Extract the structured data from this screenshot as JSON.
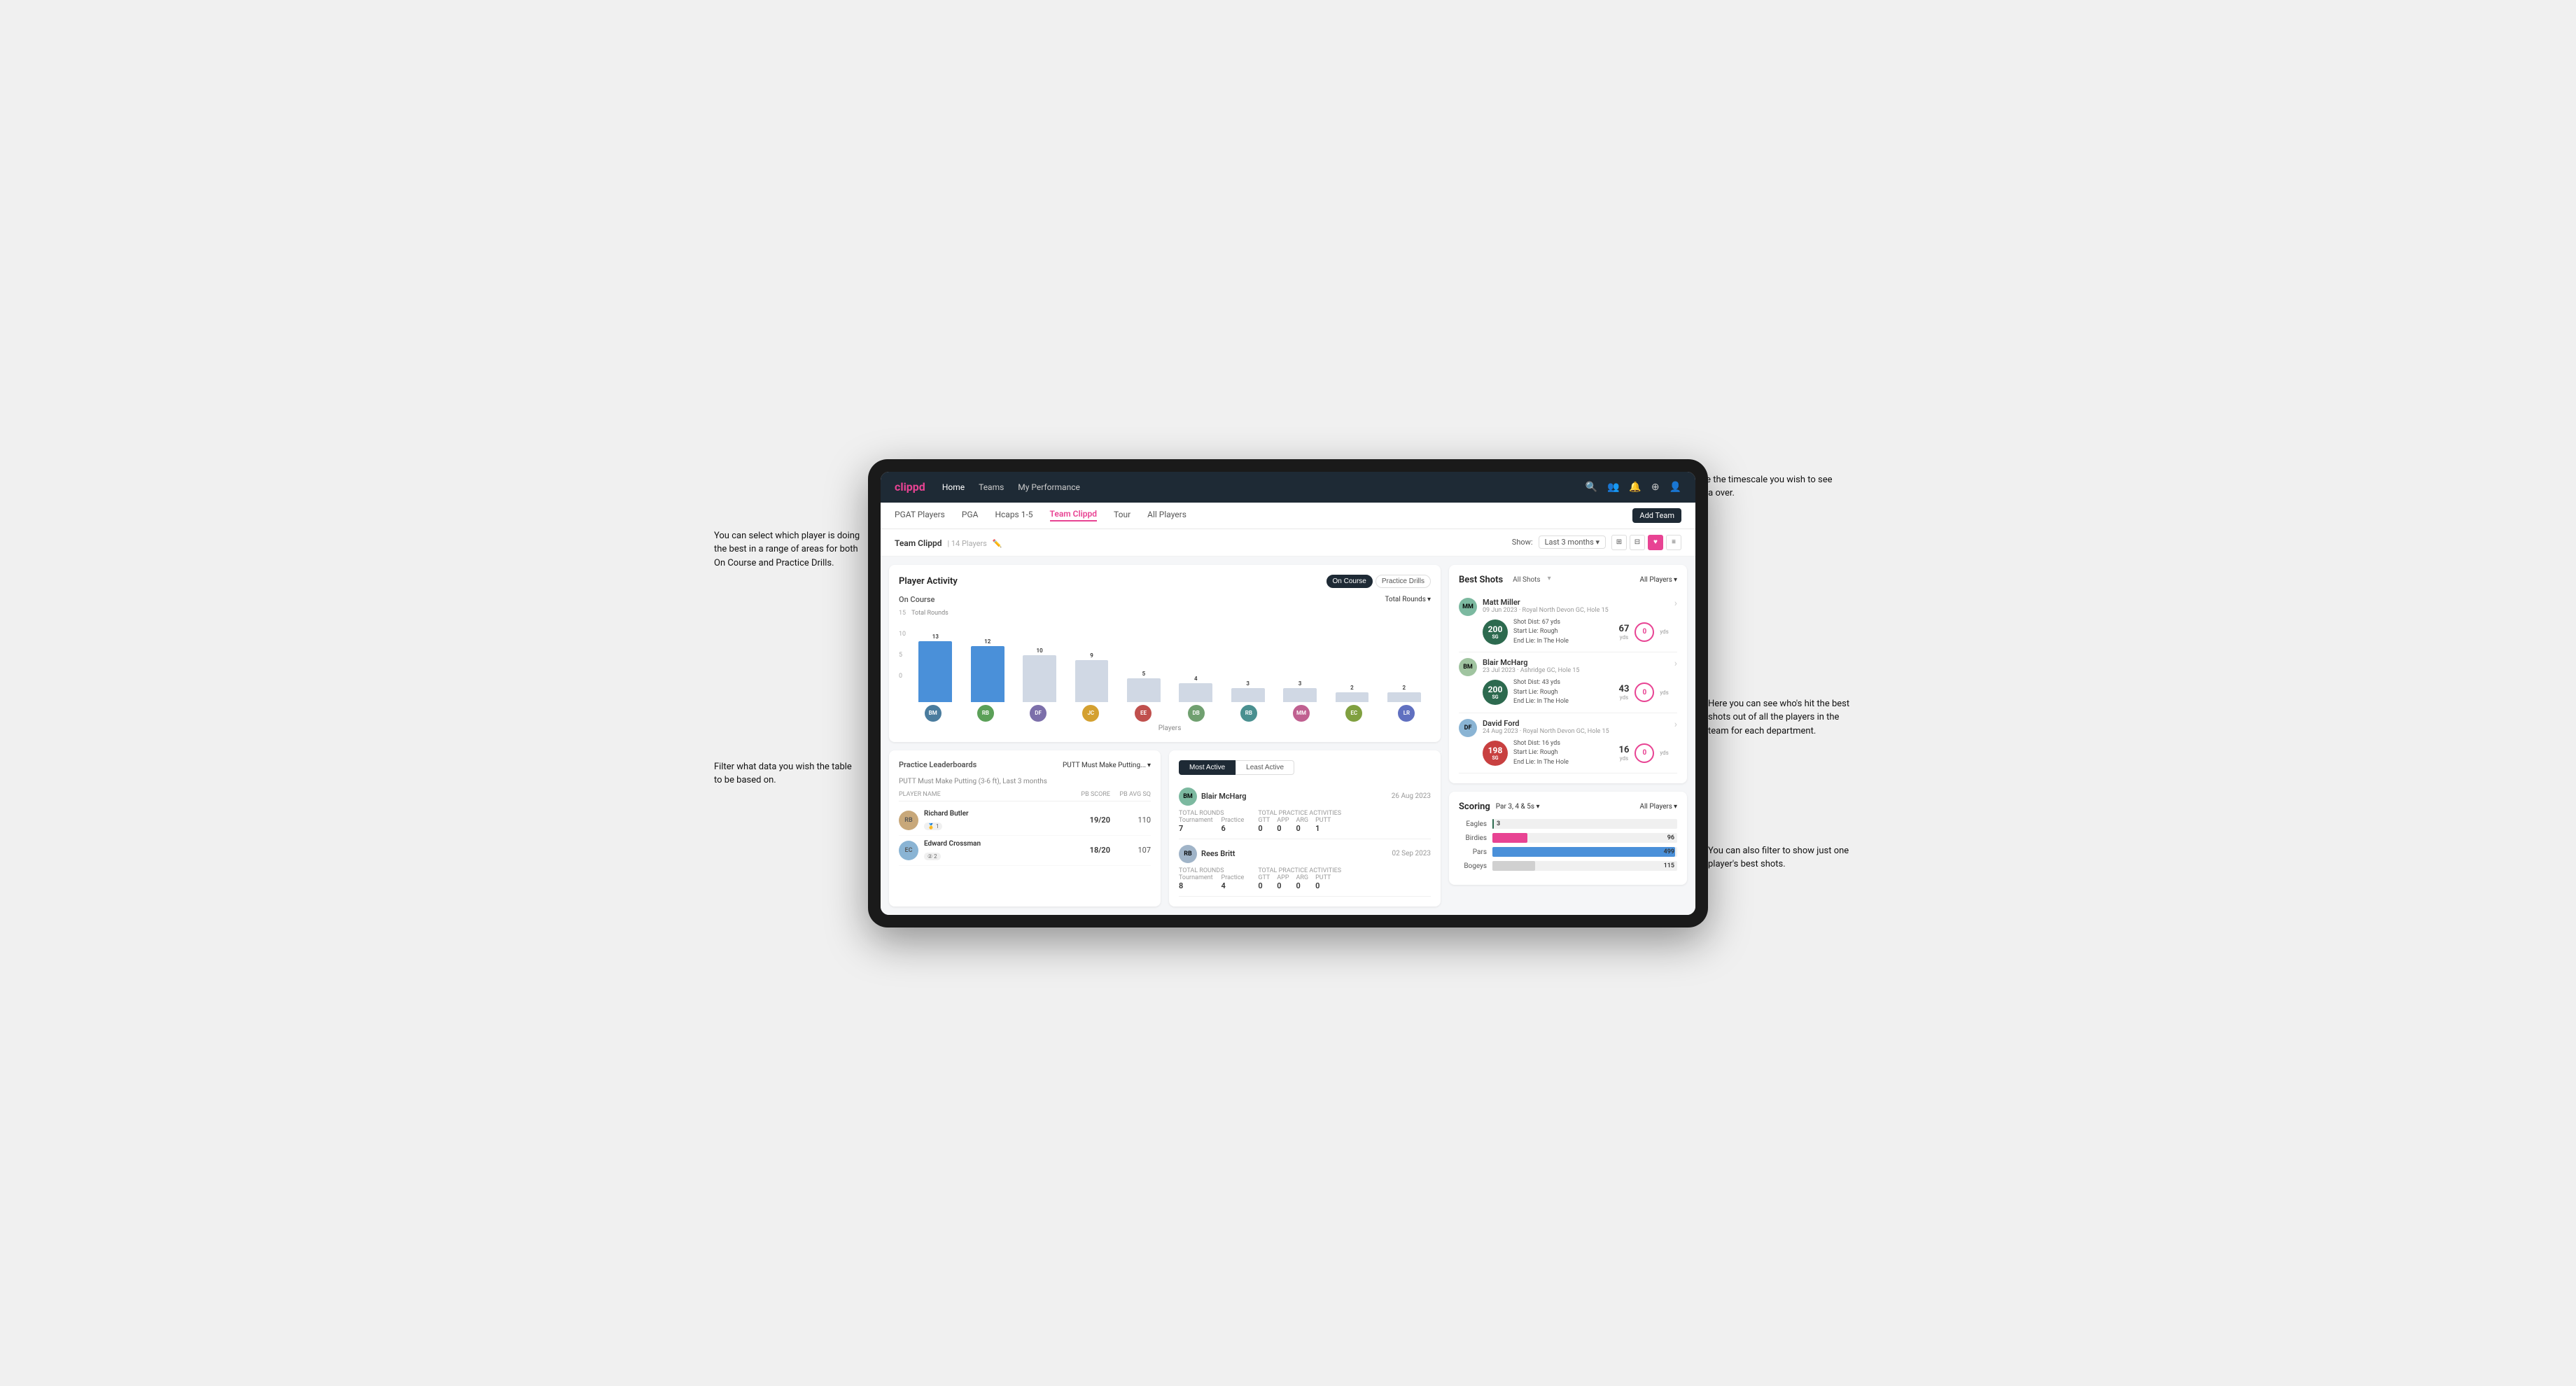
{
  "annotations": {
    "top_right": "Choose the timescale you wish to see the data over.",
    "top_left": "You can select which player is doing the best in a range of areas for both On Course and Practice Drills.",
    "bottom_left": "Filter what data you wish the table to be based on.",
    "mid_right": "Here you can see who's hit the best shots out of all the players in the team for each department.",
    "bottom_right": "You can also filter to show just one player's best shots."
  },
  "nav": {
    "logo": "clippd",
    "items": [
      "Home",
      "Teams",
      "My Performance"
    ],
    "icons": [
      "search",
      "people",
      "bell",
      "add-circle",
      "user"
    ]
  },
  "sub_nav": {
    "items": [
      "PGAT Players",
      "PGA",
      "Hcaps 1-5",
      "Team Clippd",
      "Tour",
      "All Players"
    ],
    "active": "Team Clippd",
    "add_button": "Add Team"
  },
  "team_header": {
    "title": "Team Clippd",
    "count": "14 Players",
    "show_label": "Show:",
    "timescale": "Last 3 months",
    "view_modes": [
      "grid-2x2",
      "grid-3x3",
      "heart",
      "filter"
    ]
  },
  "player_activity": {
    "title": "Player Activity",
    "toggle_on_course": "On Course",
    "toggle_practice": "Practice Drills",
    "section_title": "On Course",
    "chart_dropdown": "Total Rounds",
    "x_axis_label": "Players",
    "bars": [
      {
        "name": "B. McHarg",
        "value": 13,
        "highlight": true
      },
      {
        "name": "R. Britt",
        "value": 12,
        "highlight": true
      },
      {
        "name": "D. Ford",
        "value": 10,
        "highlight": false
      },
      {
        "name": "J. Coles",
        "value": 9,
        "highlight": false
      },
      {
        "name": "E. Ebert",
        "value": 5,
        "highlight": false
      },
      {
        "name": "D. Billingham",
        "value": 4,
        "highlight": false
      },
      {
        "name": "R. Butler",
        "value": 3,
        "highlight": false
      },
      {
        "name": "M. Miller",
        "value": 3,
        "highlight": false
      },
      {
        "name": "E. Crossman",
        "value": 2,
        "highlight": false
      },
      {
        "name": "L. Robertson",
        "value": 2,
        "highlight": false
      }
    ],
    "y_axis": [
      "15",
      "10",
      "5",
      "0"
    ]
  },
  "best_shots": {
    "title": "Best Shots",
    "tabs": [
      "All Shots",
      "Best Shots"
    ],
    "active_tab": "All Shots",
    "players_dropdown": "All Players",
    "entries": [
      {
        "name": "Matt Miller",
        "date": "09 Jun 2023",
        "course": "Royal North Devon GC",
        "hole": "Hole 15",
        "score": "200",
        "score_label": "SG",
        "shot_dist": "67 yds",
        "start_lie": "Rough",
        "end_lie": "In The Hole",
        "yds": "67",
        "zero": "0"
      },
      {
        "name": "Blair McHarg",
        "date": "23 Jul 2023",
        "course": "Ashridge GC",
        "hole": "Hole 15",
        "score": "200",
        "score_label": "SG",
        "shot_dist": "43 yds",
        "start_lie": "Rough",
        "end_lie": "In The Hole",
        "yds": "43",
        "zero": "0"
      },
      {
        "name": "David Ford",
        "date": "24 Aug 2023",
        "course": "Royal North Devon GC",
        "hole": "Hole 15",
        "score": "198",
        "score_label": "SG",
        "shot_dist": "16 yds",
        "start_lie": "Rough",
        "end_lie": "In The Hole",
        "yds": "16",
        "zero": "0"
      }
    ]
  },
  "practice_leaderboards": {
    "title": "Practice Leaderboards",
    "drill_dropdown": "PUTT Must Make Putting...",
    "subtitle": "PUTT Must Make Putting (3-6 ft), Last 3 months",
    "columns": {
      "name": "PLAYER NAME",
      "pb_score": "PB SCORE",
      "pb_avg_sq": "PB AVG SQ"
    },
    "rows": [
      {
        "name": "Richard Butler",
        "rank": 1,
        "rank_icon": "🥇",
        "pb_score": "19/20",
        "pb_avg_sq": "110"
      },
      {
        "name": "Edward Crossman",
        "rank": 2,
        "rank_icon": "②",
        "pb_score": "18/20",
        "pb_avg_sq": "107"
      }
    ]
  },
  "most_active": {
    "tabs": [
      "Most Active",
      "Least Active"
    ],
    "active_tab": "Most Active",
    "entries": [
      {
        "name": "Blair McHarg",
        "date": "26 Aug 2023",
        "total_rounds_label": "Total Rounds",
        "tournament": "7",
        "practice": "6",
        "practice_activities_label": "Total Practice Activities",
        "gtt": "0",
        "app": "0",
        "arg": "0",
        "putt": "1"
      },
      {
        "name": "Rees Britt",
        "date": "02 Sep 2023",
        "total_rounds_label": "Total Rounds",
        "tournament": "8",
        "practice": "4",
        "practice_activities_label": "Total Practice Activities",
        "gtt": "0",
        "app": "0",
        "arg": "0",
        "putt": "0"
      }
    ]
  },
  "scoring": {
    "title": "Scoring",
    "par_dropdown": "Par 3, 4 & 5s",
    "players_dropdown": "All Players",
    "bars": [
      {
        "label": "Eagles",
        "value": 3,
        "max": 500,
        "color": "#2d6a4f"
      },
      {
        "label": "Birdies",
        "value": 96,
        "max": 500,
        "color": "#e84393"
      },
      {
        "label": "Pars",
        "value": 499,
        "max": 500,
        "color": "#4a90d9"
      },
      {
        "label": "Bogeys",
        "value": 115,
        "max": 500,
        "color": "#f0c040"
      }
    ]
  },
  "colors": {
    "primary": "#e84393",
    "dark_nav": "#1e2a35",
    "accent_blue": "#4a90d9",
    "accent_green": "#2d6a4f",
    "bar_default": "#d0d8e4",
    "bar_highlight": "#4a90d9"
  }
}
